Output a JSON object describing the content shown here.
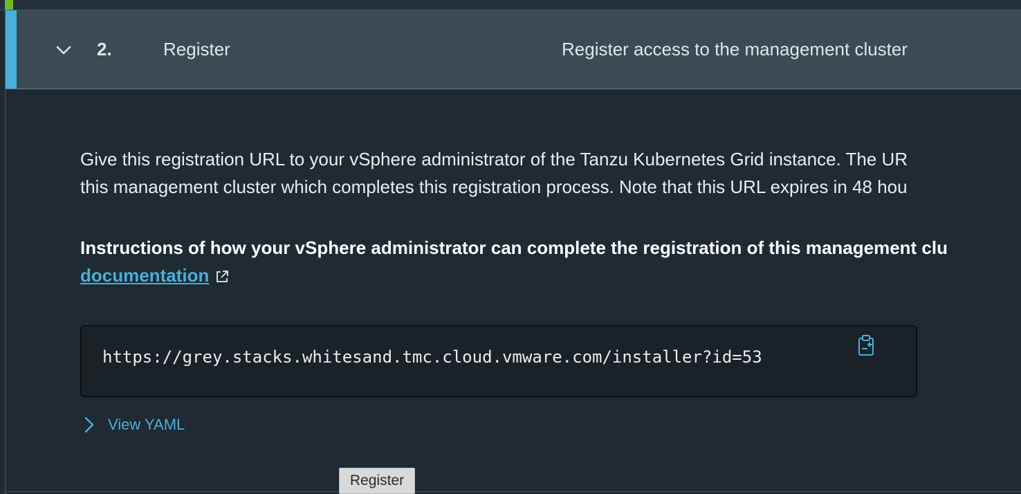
{
  "step": {
    "number": "2.",
    "title": "Register",
    "description": "Register access to the management cluster"
  },
  "content": {
    "intro_line_1": "Give this registration URL to your vSphere administrator of the Tanzu Kubernetes Grid instance. The UR",
    "intro_line_2": "this management cluster which completes this registration process. Note that this URL expires in 48 hou",
    "instructions_line_1": "Instructions of how your vSphere administrator can complete the registration of this management clu",
    "documentation_link": "documentation"
  },
  "registration": {
    "url": "https://grey.stacks.whitesand.tmc.cloud.vmware.com/installer?id=53"
  },
  "view_yaml_label": "View YAML",
  "tooltip_text": "Register",
  "colors": {
    "accent": "#49afd9",
    "header_bg": "#3c4a54",
    "page_bg": "#1f2a33",
    "top_accent": "#6fb82c"
  },
  "icons": {
    "chevron": "chevron-down-icon",
    "external": "external-link-icon",
    "copy": "copy-to-clipboard-icon",
    "yaml_chevron": "chevron-right-icon"
  }
}
